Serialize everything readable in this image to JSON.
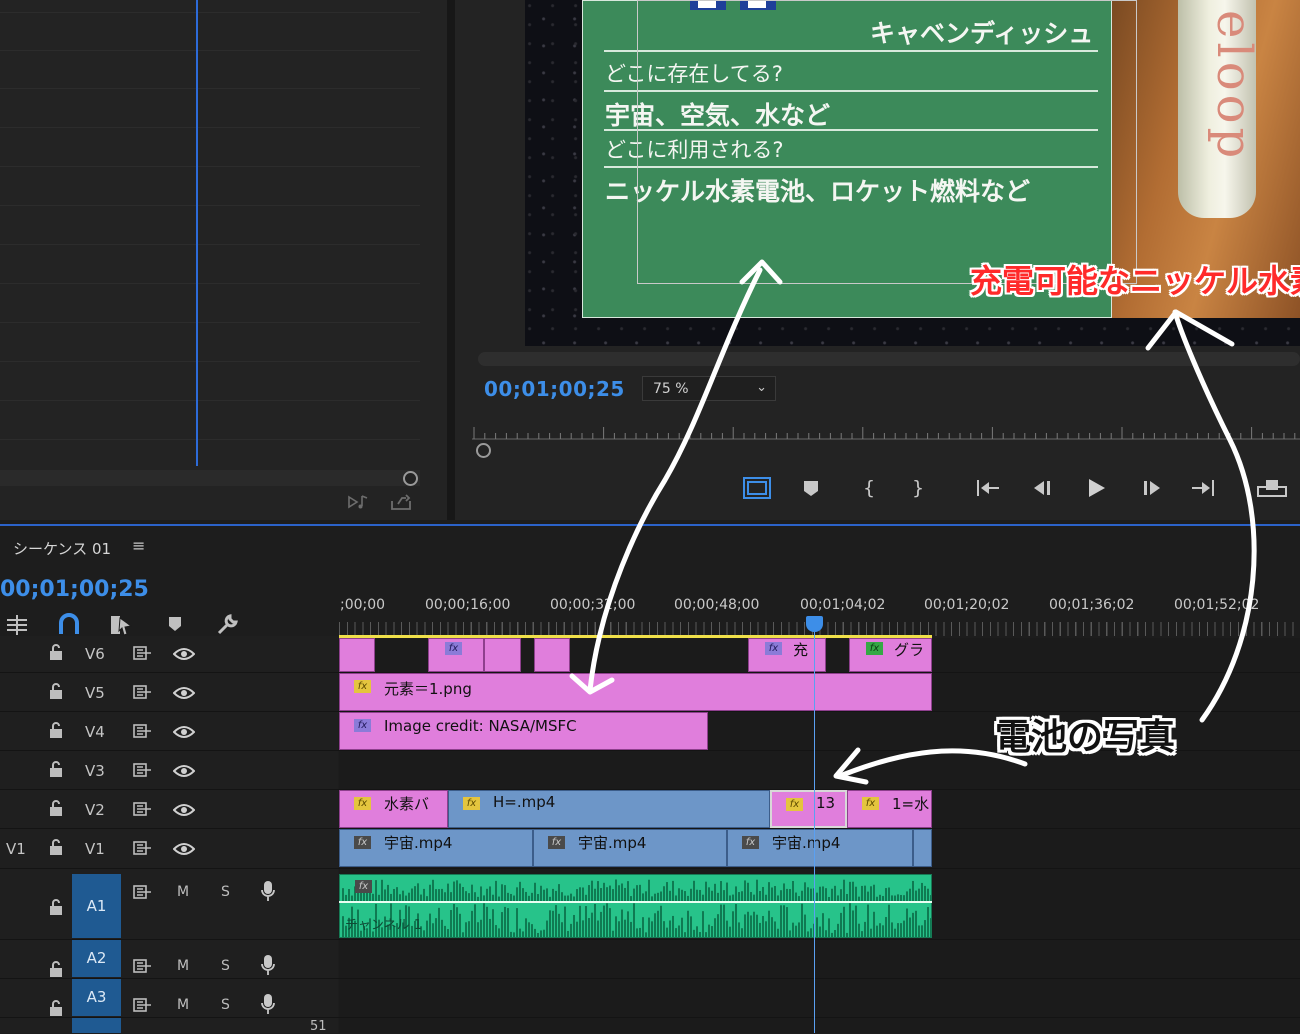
{
  "program": {
    "timecode": "00;01;00;25",
    "zoom": "75 %",
    "board": {
      "title_fragment": "キャベンディッシュ",
      "q1": "どこに存在してる?",
      "a1": "宇宙、空気、水など",
      "q2": "どこに利用される?",
      "a2": "ニッケル水素電池、ロケット燃料など"
    },
    "caption": "充電可能なニッケル水素",
    "battery_text": "eloop"
  },
  "sequence": {
    "tab_label": "シーケンス 01",
    "menu_icon": "≡",
    "timecode": "00;01;00;25",
    "ruler_labels": [
      ";00;00",
      "00;00;16;00",
      "00;00;32;00",
      "00;00;48;00",
      "00;01;04;02",
      "00;01;20;02",
      "00;01;36;02",
      "00;01;52;02"
    ],
    "ruler_label_2_visible": "00;00;3",
    "ruler_label_2_tail": ";00"
  },
  "tracks": {
    "video": [
      "V6",
      "V5",
      "V4",
      "V3",
      "V2",
      "V1"
    ],
    "source_patch": "V1",
    "audio": [
      "A1",
      "A2",
      "A3"
    ],
    "audio_buttons": {
      "mute": "M",
      "solo": "S"
    }
  },
  "clips": {
    "v6_a": "充",
    "v6_b": "グラ",
    "v5": "元素＝1.png",
    "v4": "Image credit: NASA/MSFC",
    "v2_a": "水素バ",
    "v2_b": "H=.mp4",
    "v2_c": "13",
    "v2_d": "1=水",
    "v1_a": "宇宙.mp4",
    "v1_b": "宇宙.mp4",
    "v1_c": "宇宙.mp4",
    "audio_channel": "チャンネル 1",
    "fx": "fx"
  },
  "annotation": {
    "label": "電池の写真"
  },
  "footer_number": "51",
  "colors": {
    "accent_blue": "#3d8ee8",
    "clip_pink": "#e07edc",
    "clip_blue": "#6d96c8",
    "audio_green": "#27c38a",
    "board_green": "#3c8a5a",
    "caption_red": "#ff2a2a"
  }
}
